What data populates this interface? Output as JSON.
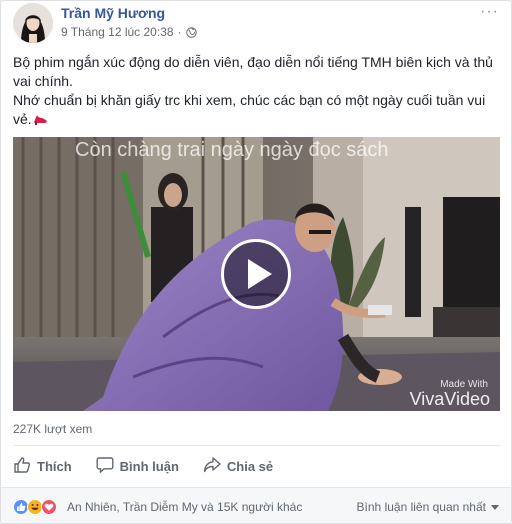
{
  "post": {
    "author": "Trần Mỹ Hương",
    "timestamp": "9 Tháng 12 lúc 20:38",
    "privacy_icon": "globe-icon",
    "more_label": "···",
    "text_line1": "Bộ phim ngắn xúc động do diễn viên, đạo diễn nổi tiếng TMH biên kịch và thủ vai chính.",
    "text_line2": "Nhớ chuẩn bị khăn giấy trc khi xem, chúc các bạn có một ngày cuối tuần vui vẻ."
  },
  "video": {
    "title_overlay": "Còn chàng trai ngày ngày đọc sách",
    "watermark_small": "Made With",
    "watermark_big": "VivaVideo",
    "views": "227K lượt xem"
  },
  "actions": {
    "like": "Thích",
    "comment": "Bình luận",
    "share": "Chia sẻ"
  },
  "footer": {
    "reaction_icons": [
      "like-icon",
      "haha-icon",
      "love-icon"
    ],
    "reaction_names": "An Nhiên, Trần Diễm My và 15K người khác",
    "comment_filter": "Bình luận liên quan nhất"
  },
  "colors": {
    "link_blue": "#365899",
    "secondary_text": "#616770",
    "like_blue": "#5890ff",
    "love_red": "#f25268",
    "haha_yellow": "#f7b125"
  }
}
